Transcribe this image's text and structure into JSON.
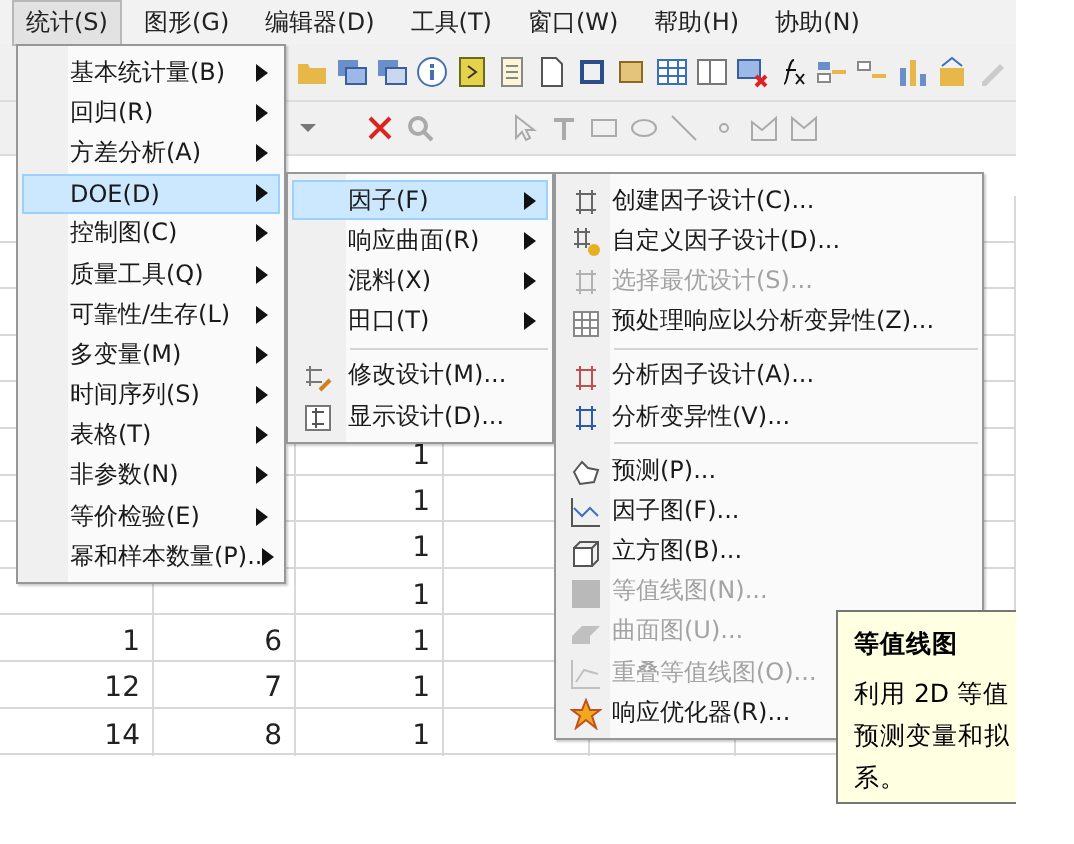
{
  "menubar": [
    {
      "label": "统计(S)",
      "selected": true
    },
    {
      "label": "图形(G)",
      "selected": false
    },
    {
      "label": "编辑器(D)",
      "selected": false
    },
    {
      "label": "工具(T)",
      "selected": false
    },
    {
      "label": "窗口(W)",
      "selected": false
    },
    {
      "label": "帮助(H)",
      "selected": false
    },
    {
      "label": "协助(N)",
      "selected": false
    }
  ],
  "stat_menu": [
    {
      "label": "基本统计量(B)",
      "submenu": true,
      "selected": false
    },
    {
      "label": "回归(R)",
      "submenu": true,
      "selected": false
    },
    {
      "label": "方差分析(A)",
      "submenu": true,
      "selected": false
    },
    {
      "label": "DOE(D)",
      "submenu": true,
      "selected": true
    },
    {
      "label": "控制图(C)",
      "submenu": true,
      "selected": false
    },
    {
      "label": "质量工具(Q)",
      "submenu": true,
      "selected": false
    },
    {
      "label": "可靠性/生存(L)",
      "submenu": true,
      "selected": false
    },
    {
      "label": "多变量(M)",
      "submenu": true,
      "selected": false
    },
    {
      "label": "时间序列(S)",
      "submenu": true,
      "selected": false
    },
    {
      "label": "表格(T)",
      "submenu": true,
      "selected": false
    },
    {
      "label": "非参数(N)",
      "submenu": true,
      "selected": false
    },
    {
      "label": "等价检验(E)",
      "submenu": true,
      "selected": false
    },
    {
      "label": "幂和样本数量(P)..",
      "submenu": true,
      "selected": false
    }
  ],
  "doe_menu": [
    {
      "kind": "item",
      "label": "因子(F)",
      "submenu": true,
      "selected": true
    },
    {
      "kind": "item",
      "label": "响应曲面(R)",
      "submenu": true,
      "selected": false
    },
    {
      "kind": "item",
      "label": "混料(X)",
      "submenu": true,
      "selected": false
    },
    {
      "kind": "item",
      "label": "田口(T)",
      "submenu": true,
      "selected": false
    },
    {
      "kind": "separator"
    },
    {
      "kind": "item",
      "label": "修改设计(M)...",
      "submenu": false,
      "selected": false
    },
    {
      "kind": "item",
      "label": "显示设计(D)...",
      "submenu": false,
      "selected": false
    }
  ],
  "factorial_menu": [
    {
      "kind": "item",
      "label": "创建因子设计(C)...",
      "disabled": false
    },
    {
      "kind": "item",
      "label": "自定义因子设计(D)...",
      "disabled": false
    },
    {
      "kind": "item",
      "label": "选择最优设计(S)...",
      "disabled": true
    },
    {
      "kind": "item",
      "label": "预处理响应以分析变异性(Z)...",
      "disabled": false
    },
    {
      "kind": "separator"
    },
    {
      "kind": "item",
      "label": "分析因子设计(A)...",
      "disabled": false
    },
    {
      "kind": "item",
      "label": "分析变异性(V)...",
      "disabled": false
    },
    {
      "kind": "separator"
    },
    {
      "kind": "item",
      "label": "预测(P)...",
      "disabled": false
    },
    {
      "kind": "item",
      "label": "因子图(F)...",
      "disabled": false
    },
    {
      "kind": "item",
      "label": "立方图(B)...",
      "disabled": false
    },
    {
      "kind": "item",
      "label": "等值线图(N)...",
      "disabled": true
    },
    {
      "kind": "item",
      "label": "曲面图(U)...",
      "disabled": true
    },
    {
      "kind": "item",
      "label": "重叠等值线图(O)...",
      "disabled": true
    },
    {
      "kind": "item",
      "label": "响应优化器(R)...",
      "disabled": false
    }
  ],
  "tooltip": {
    "title": "等值线图",
    "lines": [
      "利用 2D 等值",
      "预测变量和拟",
      "系。"
    ]
  },
  "worksheet": {
    "rows": [
      {
        "col_3": "1"
      },
      {
        "col_3": "1"
      },
      {
        "col_3": "1"
      },
      {
        "col_3": "1"
      },
      {
        "col_1": "1",
        "col_2": "6",
        "col_3": "1"
      },
      {
        "col_1": "12",
        "col_2": "7",
        "col_3": "1"
      },
      {
        "col_1": "14",
        "col_2": "8",
        "col_3": "1"
      }
    ]
  }
}
